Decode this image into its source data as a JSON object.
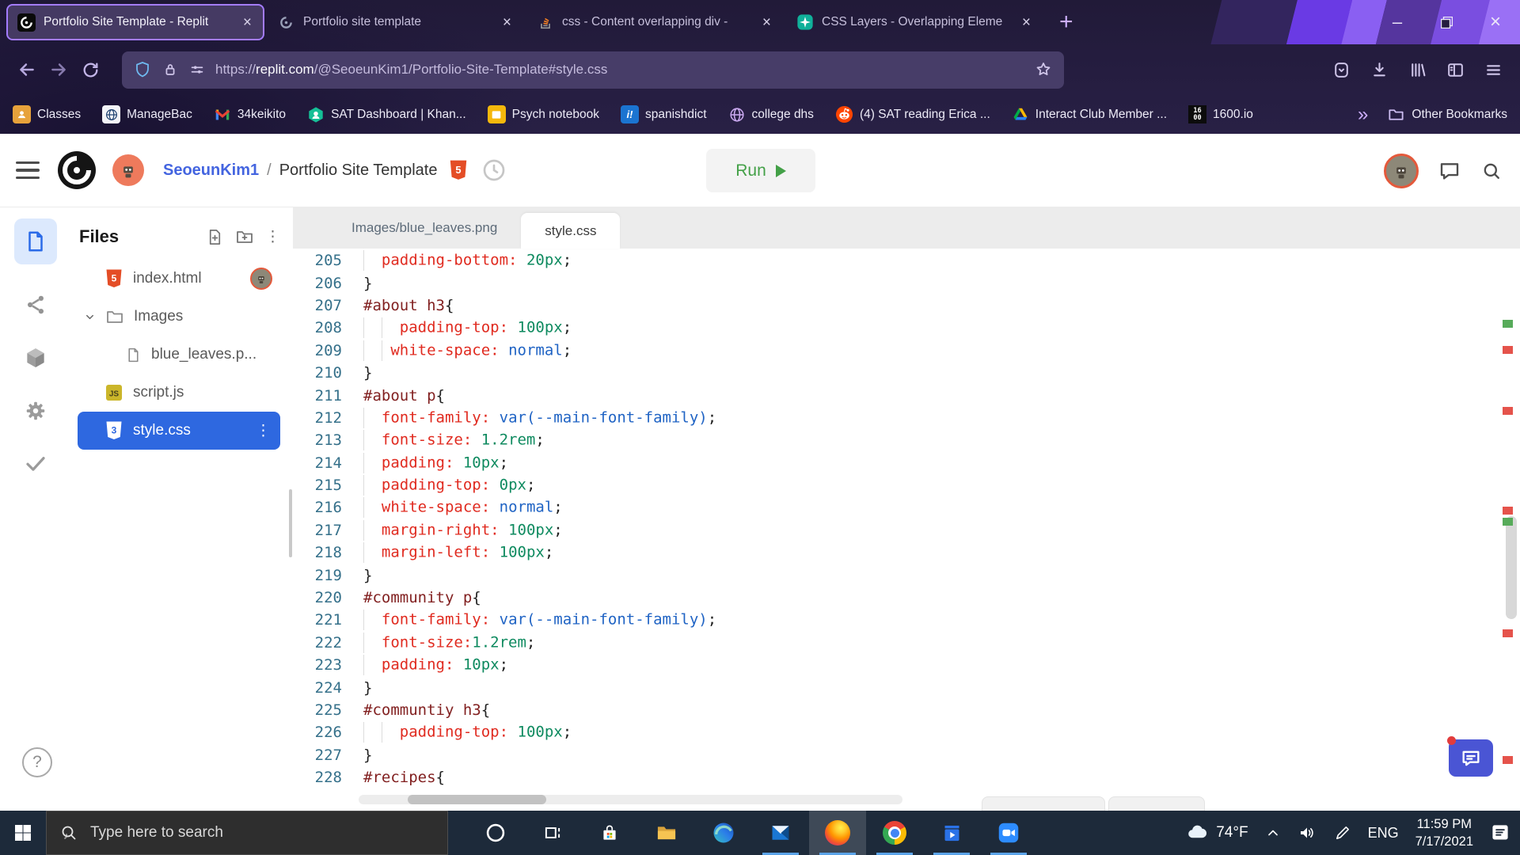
{
  "browser": {
    "tabs": [
      {
        "title": "Portfolio Site Template - Replit",
        "icon": "replit",
        "active": true
      },
      {
        "title": "Portfolio site template",
        "icon": "replit-dim",
        "active": false
      },
      {
        "title": "css - Content overlapping div -",
        "icon": "stackoverflow",
        "active": false
      },
      {
        "title": "CSS Layers - Overlapping Eleme",
        "icon": "csstricks",
        "active": false
      }
    ],
    "url_prefix": "https://",
    "url_domain": "replit.com",
    "url_path": "/@SeoeunKim1/Portfolio-Site-Template#style.css",
    "bookmarks": [
      {
        "label": "Classes",
        "icon": "classes"
      },
      {
        "label": "ManageBac",
        "icon": "managebac"
      },
      {
        "label": "34keikito",
        "icon": "gmail"
      },
      {
        "label": "SAT Dashboard | Khan...",
        "icon": "khan"
      },
      {
        "label": "Psych notebook",
        "icon": "notebook"
      },
      {
        "label": "spanishdict",
        "icon": "spanishdict"
      },
      {
        "label": "college dhs",
        "icon": "globe"
      },
      {
        "label": "(4) SAT reading Erica ...",
        "icon": "reddit"
      },
      {
        "label": "Interact Club Member ...",
        "icon": "drive"
      },
      {
        "label": "1600.io",
        "icon": "sixteen",
        "icon_text": [
          "16",
          "00"
        ]
      }
    ],
    "other_bookmarks_label": "Other Bookmarks"
  },
  "replit": {
    "username": "SeoeunKim1",
    "path_sep": "/",
    "project": "Portfolio Site Template",
    "run_label": "Run",
    "help_label": "?",
    "files": {
      "title": "Files",
      "items": [
        {
          "name": "index.html",
          "icon": "html5",
          "level": 1,
          "badge": true
        },
        {
          "name": "Images",
          "icon": "folder",
          "level": 1,
          "caret": true
        },
        {
          "name": "blue_leaves.p...",
          "icon": "file",
          "level": 2
        },
        {
          "name": "script.js",
          "icon": "js",
          "level": 1
        },
        {
          "name": "style.css",
          "icon": "css",
          "level": 1,
          "selected": true,
          "kebab": true
        }
      ]
    },
    "editor": {
      "tabs": [
        {
          "label": "Images/blue_leaves.png",
          "active": false
        },
        {
          "label": "style.css",
          "active": true
        }
      ],
      "lines": [
        {
          "n": 205,
          "seg": [
            [
              "g"
            ],
            [
              "s",
              "  "
            ],
            [
              "p",
              "padding-bottom:"
            ],
            [
              "s",
              " "
            ],
            [
              "v",
              "20px"
            ],
            [
              "d",
              ";"
            ]
          ]
        },
        {
          "n": 206,
          "seg": [
            [
              "d",
              "}"
            ]
          ]
        },
        {
          "n": 207,
          "seg": [
            [
              "sel",
              "#about h3"
            ],
            [
              "d",
              "{"
            ]
          ]
        },
        {
          "n": 208,
          "seg": [
            [
              "g"
            ],
            [
              "s",
              "  "
            ],
            [
              "g"
            ],
            [
              "s",
              "  "
            ],
            [
              "p",
              "padding-top:"
            ],
            [
              "s",
              " "
            ],
            [
              "v",
              "100px"
            ],
            [
              "d",
              ";"
            ]
          ]
        },
        {
          "n": 209,
          "seg": [
            [
              "g"
            ],
            [
              "s",
              "  "
            ],
            [
              "g"
            ],
            [
              "s",
              " "
            ],
            [
              "p",
              "white-space:"
            ],
            [
              "s",
              " "
            ],
            [
              "k",
              "normal"
            ],
            [
              "d",
              ";"
            ]
          ]
        },
        {
          "n": 210,
          "seg": [
            [
              "d",
              "}"
            ]
          ]
        },
        {
          "n": 211,
          "seg": [
            [
              "sel",
              "#about p"
            ],
            [
              "d",
              "{"
            ]
          ]
        },
        {
          "n": 212,
          "seg": [
            [
              "g"
            ],
            [
              "s",
              "  "
            ],
            [
              "p",
              "font-family:"
            ],
            [
              "s",
              " "
            ],
            [
              "k",
              "var(--main-font-family)"
            ],
            [
              "d",
              ";"
            ]
          ]
        },
        {
          "n": 213,
          "seg": [
            [
              "g"
            ],
            [
              "s",
              "  "
            ],
            [
              "p",
              "font-size:"
            ],
            [
              "s",
              " "
            ],
            [
              "v",
              "1.2rem"
            ],
            [
              "d",
              ";"
            ]
          ]
        },
        {
          "n": 214,
          "seg": [
            [
              "g"
            ],
            [
              "s",
              "  "
            ],
            [
              "p",
              "padding:"
            ],
            [
              "s",
              " "
            ],
            [
              "v",
              "10px"
            ],
            [
              "d",
              ";"
            ]
          ]
        },
        {
          "n": 215,
          "seg": [
            [
              "g"
            ],
            [
              "s",
              "  "
            ],
            [
              "p",
              "padding-top:"
            ],
            [
              "s",
              " "
            ],
            [
              "v",
              "0px"
            ],
            [
              "d",
              ";"
            ]
          ]
        },
        {
          "n": 216,
          "seg": [
            [
              "g"
            ],
            [
              "s",
              "  "
            ],
            [
              "p",
              "white-space:"
            ],
            [
              "s",
              " "
            ],
            [
              "k",
              "normal"
            ],
            [
              "d",
              ";"
            ]
          ]
        },
        {
          "n": 217,
          "seg": [
            [
              "g"
            ],
            [
              "s",
              "  "
            ],
            [
              "p",
              "margin-right:"
            ],
            [
              "s",
              " "
            ],
            [
              "v",
              "100px"
            ],
            [
              "d",
              ";"
            ]
          ]
        },
        {
          "n": 218,
          "seg": [
            [
              "g"
            ],
            [
              "s",
              "  "
            ],
            [
              "p",
              "margin-left:"
            ],
            [
              "s",
              " "
            ],
            [
              "v",
              "100px"
            ],
            [
              "d",
              ";"
            ]
          ]
        },
        {
          "n": 219,
          "seg": [
            [
              "d",
              "}"
            ]
          ]
        },
        {
          "n": 220,
          "seg": [
            [
              "sel",
              "#community p"
            ],
            [
              "d",
              "{"
            ]
          ]
        },
        {
          "n": 221,
          "seg": [
            [
              "g"
            ],
            [
              "s",
              "  "
            ],
            [
              "p",
              "font-family:"
            ],
            [
              "s",
              " "
            ],
            [
              "k",
              "var(--main-font-family)"
            ],
            [
              "d",
              ";"
            ]
          ]
        },
        {
          "n": 222,
          "seg": [
            [
              "g"
            ],
            [
              "s",
              "  "
            ],
            [
              "p",
              "font-size:"
            ],
            [
              "v",
              "1.2rem"
            ],
            [
              "d",
              ";"
            ]
          ]
        },
        {
          "n": 223,
          "seg": [
            [
              "g"
            ],
            [
              "s",
              "  "
            ],
            [
              "p",
              "padding:"
            ],
            [
              "s",
              " "
            ],
            [
              "v",
              "10px"
            ],
            [
              "d",
              ";"
            ]
          ]
        },
        {
          "n": 224,
          "seg": [
            [
              "d",
              "}"
            ]
          ]
        },
        {
          "n": 225,
          "seg": [
            [
              "sel",
              "#communtiy h3"
            ],
            [
              "d",
              "{"
            ]
          ]
        },
        {
          "n": 226,
          "seg": [
            [
              "g"
            ],
            [
              "s",
              "  "
            ],
            [
              "g"
            ],
            [
              "s",
              "  "
            ],
            [
              "p",
              "padding-top:"
            ],
            [
              "s",
              " "
            ],
            [
              "v",
              "100px"
            ],
            [
              "d",
              ";"
            ]
          ]
        },
        {
          "n": 227,
          "seg": [
            [
              "d",
              "}"
            ]
          ]
        },
        {
          "n": 228,
          "seg": [
            [
              "sel",
              "#recipes"
            ],
            [
              "d",
              "{"
            ]
          ]
        }
      ]
    }
  },
  "taskbar": {
    "search_placeholder": "Type here to search",
    "apps": [
      {
        "icon": "cortana",
        "open": false,
        "active": false
      },
      {
        "icon": "taskview",
        "open": false,
        "active": false
      },
      {
        "icon": "store",
        "open": false,
        "active": false
      },
      {
        "icon": "explorer",
        "open": false,
        "active": false
      },
      {
        "icon": "edge",
        "open": false,
        "active": false
      },
      {
        "icon": "mail",
        "open": true,
        "active": false
      },
      {
        "icon": "firefox",
        "open": true,
        "active": true
      },
      {
        "icon": "chrome",
        "open": true,
        "active": false
      },
      {
        "icon": "movies",
        "open": true,
        "active": false
      },
      {
        "icon": "zoomapp",
        "open": true,
        "active": false
      }
    ],
    "tray": {
      "temperature": "74°F",
      "language": "ENG",
      "time": "11:59 PM",
      "date": "7/17/2021"
    }
  },
  "colors": {
    "accent_purple": "#a47cff",
    "run_green": "#43a047",
    "selection_blue": "#2e68e0",
    "taskbar_underline": "#5ba3e8",
    "code_property": "#e02a1f",
    "code_value": "#0e8a5f",
    "code_keyword": "#1f63c4",
    "code_selector": "#811f1f"
  }
}
